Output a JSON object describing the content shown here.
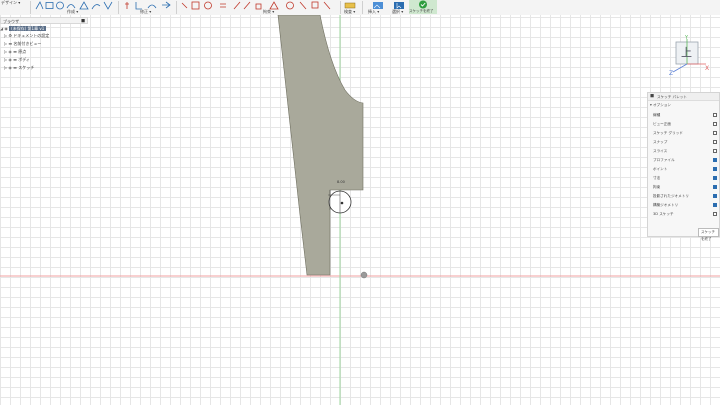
{
  "toolbar": {
    "workspace_label": "デザイン ▾",
    "groups": [
      {
        "label": "作成 ▾"
      },
      {
        "label": "修正 ▾"
      },
      {
        "label": "拘束 ▾"
      },
      {
        "label": "検査 ▾"
      },
      {
        "label": "挿入 ▾"
      },
      {
        "label": "選択 ▾"
      },
      {
        "label": "スケッチを終了"
      }
    ]
  },
  "browser": {
    "title": "ブラウザ",
    "root": "(未保存) 第1章 v1",
    "items": [
      {
        "label": "ドキュメントの設定"
      },
      {
        "label": "名前付きビュー"
      },
      {
        "label": "原点"
      },
      {
        "label": "ボディ"
      },
      {
        "label": "スケッチ"
      }
    ]
  },
  "palette": {
    "title": "スケッチ パレット",
    "section": "オプション",
    "rows": [
      {
        "label": "線種",
        "checked": false
      },
      {
        "label": "ビュー正面",
        "checked": false
      },
      {
        "label": "スケッチ グリッド",
        "checked": false
      },
      {
        "label": "スナップ",
        "checked": false
      },
      {
        "label": "スライス",
        "checked": false
      },
      {
        "label": "プロファイル",
        "checked": true
      },
      {
        "label": "ポイント",
        "checked": true
      },
      {
        "label": "寸法",
        "checked": true
      },
      {
        "label": "拘束",
        "checked": true
      },
      {
        "label": "投影されたジオメトリ",
        "checked": true
      },
      {
        "label": "構築ジオメトリ",
        "checked": true
      },
      {
        "label": "3D スケッチ",
        "checked": false
      }
    ],
    "finish_button": "スケッチを終了"
  },
  "viewcube": {
    "face_label": "上",
    "axis_x": "X",
    "axis_y": "Y",
    "axis_z": "Z"
  },
  "dimension": {
    "radius": "8.00"
  },
  "colors": {
    "sketch_fill": "#a9a99b",
    "sketch_edge": "#6f6f60",
    "x_axis": "#f0a0a0",
    "y_axis": "#9fd79f",
    "accent": "#2b6db0"
  }
}
